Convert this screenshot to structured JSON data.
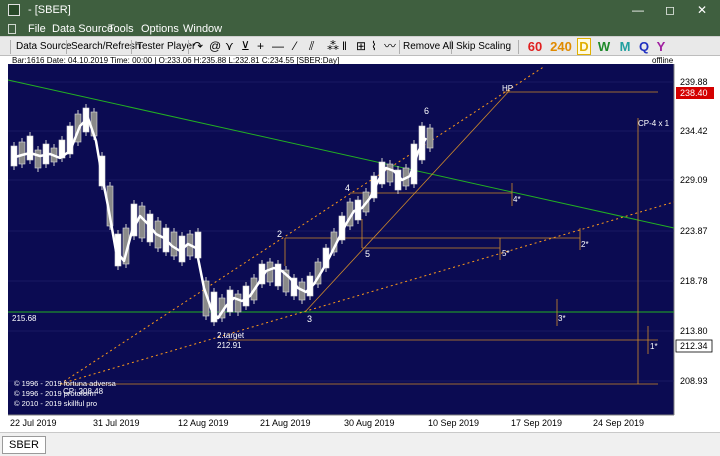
{
  "window": {
    "title": "- [SBER]",
    "controls": {
      "minimize": "—",
      "maximize": "◻",
      "close": "✕"
    }
  },
  "menu": [
    "File",
    "Data Source",
    "Tools",
    "Options",
    "Window"
  ],
  "toolbar": {
    "data_source": "Data Source",
    "search_refresh": "Search/Refresh",
    "tester_player": "Tester Player",
    "remove_all": "Remove All",
    "skip_scaling": "Skip Scaling",
    "tools_icons": [
      "↷",
      "@",
      "⋎",
      "⊻",
      "+",
      "—",
      "⁄",
      "⫽",
      "⁂",
      "‖",
      "⊞",
      "⌇",
      "〰"
    ],
    "timeframes": [
      {
        "label": "60",
        "color": "#e02020"
      },
      {
        "label": "240",
        "color": "#e08a00"
      },
      {
        "label": "D",
        "color": "#e0b000",
        "active": true
      },
      {
        "label": "W",
        "color": "#1e8a2a"
      },
      {
        "label": "M",
        "color": "#20a0a0"
      },
      {
        "label": "Q",
        "color": "#2030c0"
      },
      {
        "label": "Y",
        "color": "#a020a0"
      }
    ]
  },
  "chart": {
    "info": "Bar:1616 Date: 04.10.2019 Time: 00:00 | O:233.06 H:235.88 L:232.81 C:234.55  [SBER:Day]",
    "status": "offline",
    "price_labels": [
      "239.88",
      "234.42",
      "229.09",
      "223.87",
      "218.78",
      "213.80",
      "208.93"
    ],
    "highlight_price": "238.40",
    "last_price": "212.34",
    "left_level_label": "215.68",
    "date_labels": [
      "22 Jul 2019",
      "31 Jul 2019",
      "12 Aug 2019",
      "21 Aug 2019",
      "30 Aug 2019",
      "10 Sep 2019",
      "17 Sep 2019",
      "24 Sep 2019"
    ],
    "wave_labels": [
      "2",
      "3",
      "4",
      "5",
      "6"
    ],
    "projection_labels": [
      "HP",
      "4*",
      "5*",
      "2*",
      "3*",
      "1*"
    ],
    "cp_label": "CP-4 x 1",
    "target_label": "2.target",
    "target_value": "212.91",
    "cp_bottom_label": "CP: 208.48",
    "copyright": [
      "© 1996 - 2019 fortuna adversa",
      "© 1996 - 2019 protoform",
      "© 2010 - 2019 skillful pro"
    ]
  },
  "tab": "SBER"
}
